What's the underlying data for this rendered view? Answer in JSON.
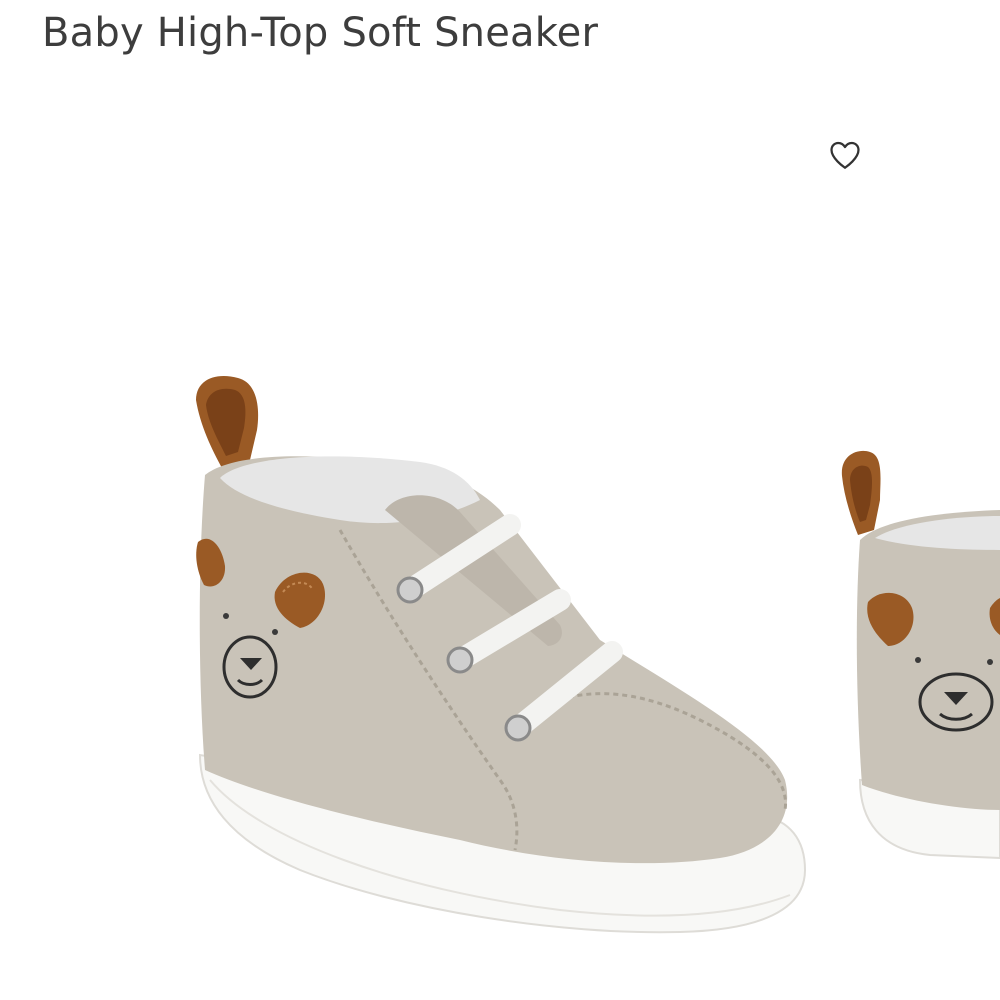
{
  "product": {
    "title": "Baby High-Top Soft Sneaker"
  },
  "wishlist": {
    "icon": "heart-outline-icon",
    "favorited": false
  },
  "gallery": {
    "images": [
      {
        "subject": "sneaker-side-view"
      },
      {
        "subject": "sneaker-second-view"
      }
    ]
  },
  "colors": {
    "title": "#3d3d3d",
    "canvas": "#c9c3b8",
    "leather": "#9a5a25",
    "sole": "#f8f8f6",
    "lining": "#e6e6e6",
    "lace": "#f3f3f1"
  }
}
